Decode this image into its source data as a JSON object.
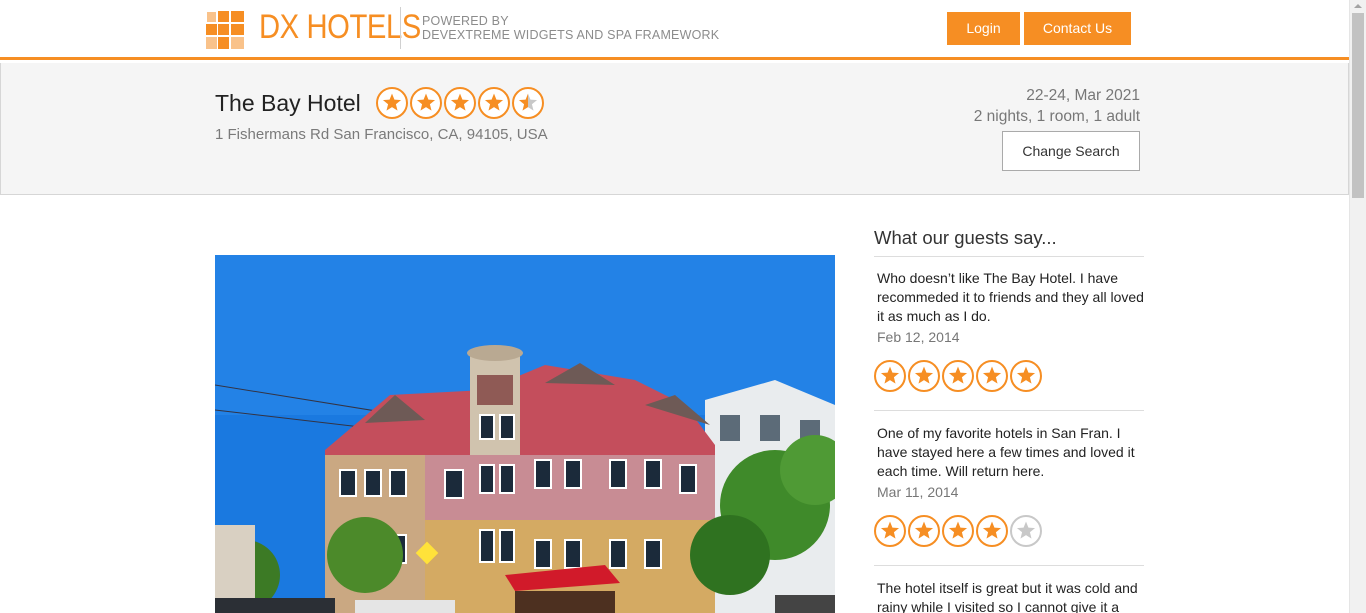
{
  "header": {
    "logo_text": "DX HOTELS",
    "powered_line1": "POWERED BY",
    "powered_line2": "DEVEXTREME WIDGETS AND SPA FRAMEWORK",
    "login_label": "Login",
    "contact_label": "Contact Us"
  },
  "hotel": {
    "name": "The Bay Hotel",
    "rating": 4.5,
    "address": "1 Fishermans Rd San Francisco, CA, 94105, USA"
  },
  "booking": {
    "dates": "22-24, Mar 2021",
    "summary": "2 nights, 1 room, 1 adult",
    "change_search_label": "Change Search"
  },
  "reviews": {
    "title": "What our guests say...",
    "items": [
      {
        "text": "Who doesn’t like The Bay Hotel. I have recommeded it to friends and they all loved it as much as I do.",
        "date": "Feb 12, 2014",
        "rating": 5
      },
      {
        "text": "One of my favorite hotels in San Fran. I have stayed here a few times and loved it each time. Will return here.",
        "date": "Mar 11, 2014",
        "rating": 4
      },
      {
        "text": "The hotel itself is great but it was cold and rainy while I visited so I cannot give it a",
        "date": "",
        "rating": 0
      }
    ]
  },
  "colors": {
    "accent": "#f68e23",
    "star_empty": "#c8c8c8"
  },
  "icons": {
    "logo": "dx-hotels-logo-icon",
    "star": "star-icon"
  }
}
